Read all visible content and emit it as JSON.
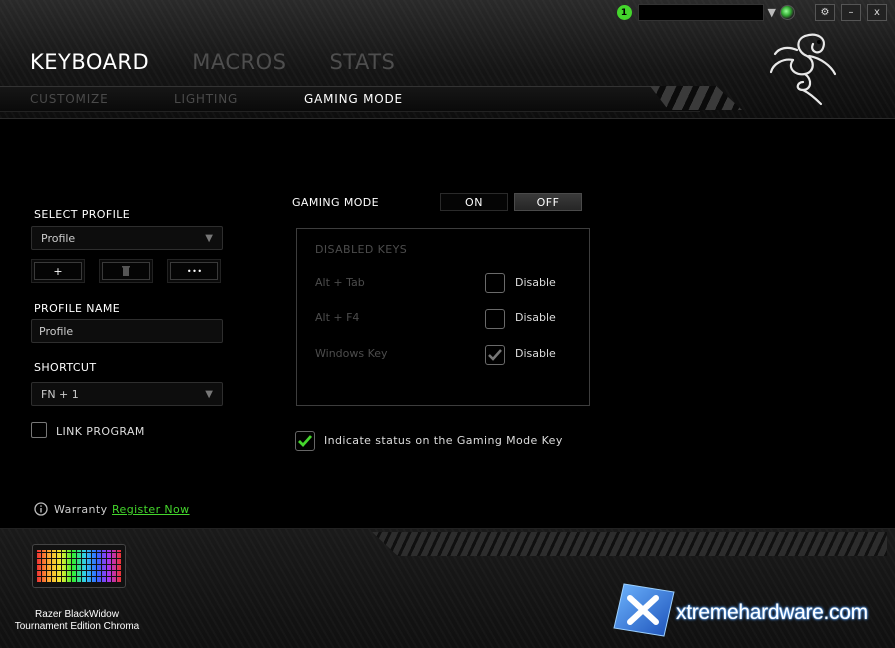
{
  "titlebar": {
    "notification_count": "1",
    "settings_label": "⚙",
    "minimize_label": "–",
    "close_label": "x"
  },
  "tabs": {
    "main": [
      {
        "label": "KEYBOARD",
        "active": true
      },
      {
        "label": "MACROS",
        "active": false
      },
      {
        "label": "STATS",
        "active": false
      }
    ],
    "sub": [
      {
        "label": "CUSTOMIZE",
        "active": false
      },
      {
        "label": "LIGHTING",
        "active": false
      },
      {
        "label": "GAMING MODE",
        "active": true
      }
    ]
  },
  "profile": {
    "select_label": "SELECT PROFILE",
    "selected": "Profile",
    "add_label": "+",
    "delete_label": "🗑",
    "more_label": "• • •",
    "name_label": "PROFILE NAME",
    "name_value": "Profile",
    "shortcut_label": "SHORTCUT",
    "shortcut_value": "FN + 1",
    "link_program_label": "LINK PROGRAM",
    "link_program_checked": false
  },
  "gaming_mode": {
    "label": "GAMING MODE",
    "on_label": "ON",
    "off_label": "OFF",
    "state": "OFF",
    "disabled_keys_title": "DISABLED KEYS",
    "keys": [
      {
        "name": "Alt + Tab",
        "option": "Disable",
        "checked": false
      },
      {
        "name": "Alt + F4",
        "option": "Disable",
        "checked": false
      },
      {
        "name": "Windows Key",
        "option": "Disable",
        "checked": true
      }
    ],
    "indicate_label": "Indicate status on the Gaming Mode Key",
    "indicate_checked": true
  },
  "warranty": {
    "label": "Warranty",
    "link": "Register Now"
  },
  "device": {
    "name_line1": "Razer BlackWidow",
    "name_line2": "Tournament Edition Chroma"
  },
  "watermark": {
    "text": "xtremehardware.com"
  },
  "colors": {
    "accent": "#44d62c",
    "background": "#000000"
  }
}
